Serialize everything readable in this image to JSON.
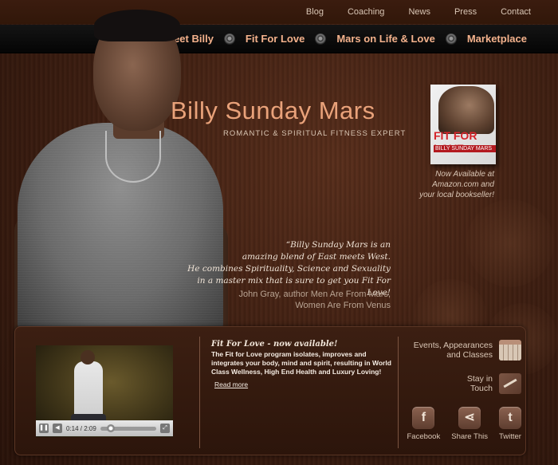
{
  "top_nav": [
    "Blog",
    "Coaching",
    "News",
    "Press",
    "Contact"
  ],
  "main_nav": [
    "Meet Billy",
    "Fit For Love",
    "Mars on Life & Love",
    "Marketplace"
  ],
  "hero": {
    "title": "Billy Sunday Mars",
    "subtitle": "ROMANTIC & SPIRITUAL FITNESS EXPERT"
  },
  "book": {
    "cover_title": "FIT FOR LOVE",
    "cover_author": "BILLY SUNDAY MARS",
    "availability_line1": "Now Available at",
    "availability_line2": "Amazon.com and",
    "availability_line3": "your local bookseller!"
  },
  "quote": {
    "line1": "“Billy Sunday Mars is an",
    "line2": "amazing blend of East meets West.",
    "line3": "He combines Spirituality, Science and Sexuality",
    "line4": "in a master mix that is sure to get you Fit For Love!",
    "attribution_line1": "John Gray, author Men Are From Mars,",
    "attribution_line2": "Women Are From Venus"
  },
  "video": {
    "timecode": "0:14 / 2:09",
    "progress": 0.11
  },
  "news": {
    "title": "Fit For Love - now available!",
    "body": "The Fit for Love program isolates, improves and integrates your body, mind and spirit, resulting in World Class Wellness, High End Health and Luxury Loving!",
    "read_more": "Read more"
  },
  "links": {
    "events_line1": "Events, Appearances",
    "events_line2": "and Classes",
    "contact_line1": "Stay in",
    "contact_line2": "Touch"
  },
  "social": [
    {
      "label": "Facebook",
      "icon": "facebook-icon",
      "glyph": "f"
    },
    {
      "label": "Share This",
      "icon": "share-icon",
      "glyph": "⋖"
    },
    {
      "label": "Twitter",
      "icon": "twitter-icon",
      "glyph": "t"
    }
  ],
  "colors": {
    "accent": "#f4b28c",
    "title": "#e9a27a",
    "background": "#3a1d10"
  }
}
